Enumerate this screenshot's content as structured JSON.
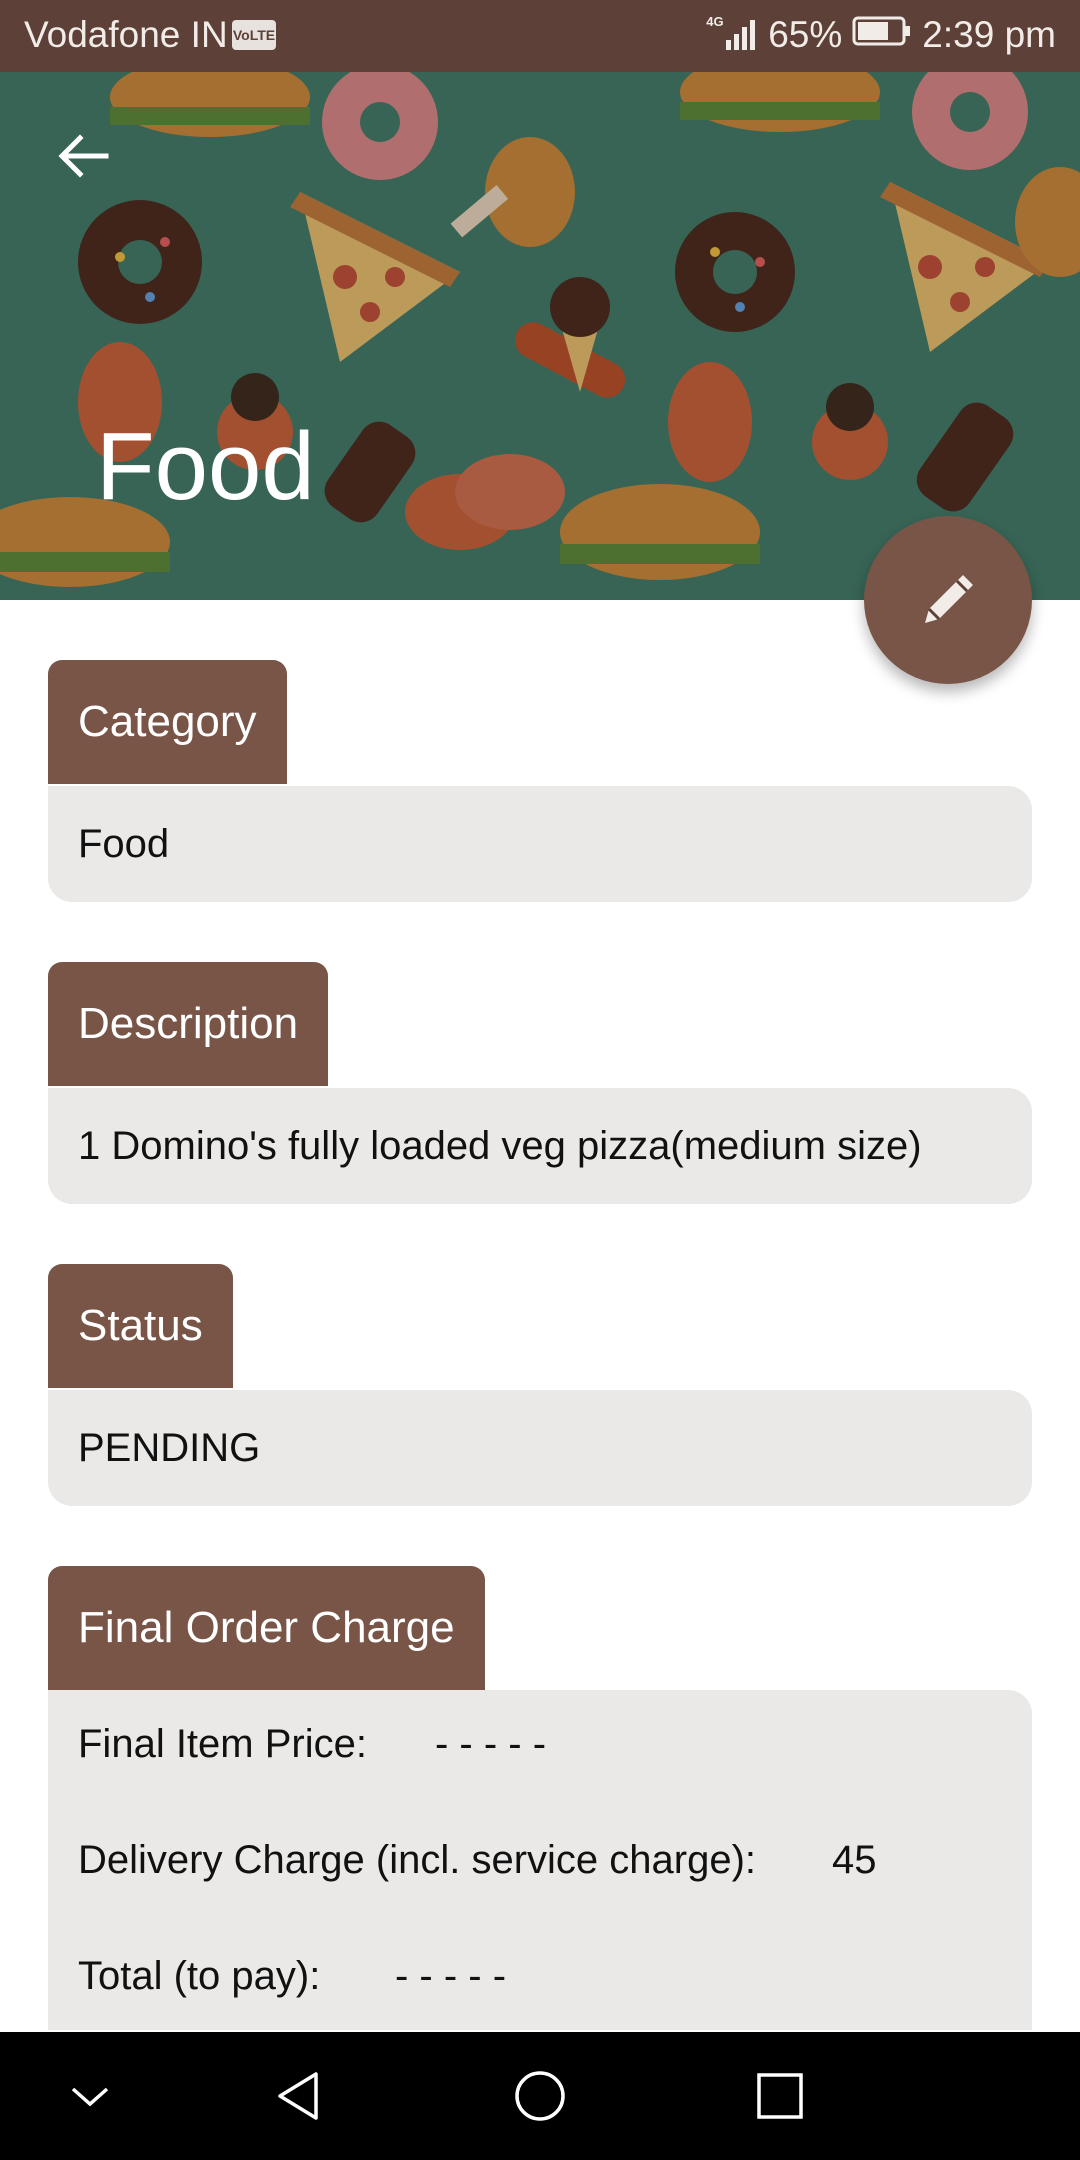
{
  "status_bar": {
    "carrier": "Vodafone IN",
    "volte": "VoLTE",
    "network": "4G",
    "battery": "65%",
    "time": "2:39 pm"
  },
  "header": {
    "title": "Food"
  },
  "sections": {
    "category": {
      "label": "Category",
      "value": "Food"
    },
    "description": {
      "label": "Description",
      "value": "1 Domino's fully loaded veg pizza(medium size)"
    },
    "status": {
      "label": "Status",
      "value": "PENDING"
    },
    "charges": {
      "label": "Final Order Charge",
      "item_price_label": "Final Item Price:",
      "item_price_value": "- - - - -",
      "delivery_label": "Delivery Charge (incl. service charge):",
      "delivery_value": "45",
      "total_label": "Total (to pay):",
      "total_value": "- - - - -"
    }
  },
  "colors": {
    "primary": "#795548",
    "primary_dark": "#5d4037",
    "field_bg": "#ebe9e7",
    "header_bg": "#3e7b6a"
  },
  "icons": [
    "back-arrow-icon",
    "pencil-icon",
    "nav-collapse-icon",
    "nav-back-icon",
    "nav-home-icon",
    "nav-recents-icon"
  ]
}
